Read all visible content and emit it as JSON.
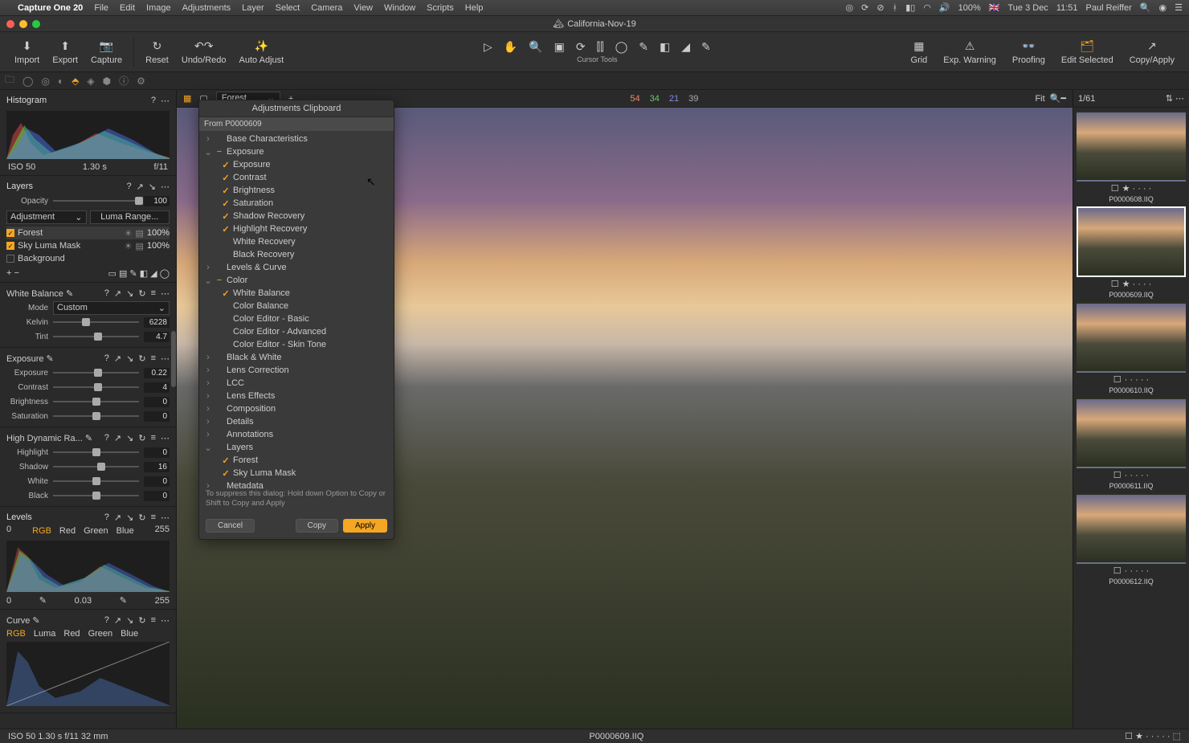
{
  "menubar": {
    "app": "Capture One 20",
    "items": [
      "File",
      "Edit",
      "Image",
      "Adjustments",
      "Layer",
      "Select",
      "Camera",
      "View",
      "Window",
      "Scripts",
      "Help"
    ],
    "battery": "100%",
    "flag": "🇬🇧",
    "date": "Tue 3 Dec",
    "time": "11:51",
    "user": "Paul Reiffer"
  },
  "window": {
    "title": "California-Nov-19",
    "doc_icon": "🏔"
  },
  "toolbar": {
    "left": [
      {
        "id": "import",
        "label": "Import",
        "icon": "⬇"
      },
      {
        "id": "export",
        "label": "Export",
        "icon": "⬆"
      },
      {
        "id": "capture",
        "label": "Capture",
        "icon": "📷"
      }
    ],
    "mid": [
      {
        "id": "reset",
        "label": "Reset",
        "icon": "↻"
      },
      {
        "id": "undoredo",
        "label": "Undo/Redo",
        "icon": "↶ ↷"
      },
      {
        "id": "autoadjust",
        "label": "Auto Adjust",
        "icon": "✨"
      }
    ],
    "cursor_label": "Cursor Tools",
    "right": [
      {
        "id": "grid",
        "label": "Grid",
        "icon": "▦"
      },
      {
        "id": "expwarn",
        "label": "Exp. Warning",
        "icon": "⚠"
      },
      {
        "id": "proofing",
        "label": "Proofing",
        "icon": "👓"
      },
      {
        "id": "editsel",
        "label": "Edit Selected",
        "icon": "🗂",
        "color": "#f5a623"
      },
      {
        "id": "copyapply",
        "label": "Copy/Apply",
        "icon": "↗"
      }
    ]
  },
  "histogram": {
    "iso": "ISO 50",
    "shutter": "1.30 s",
    "aperture": "f/11"
  },
  "layers": {
    "title": "Layers",
    "opacity_label": "Opacity",
    "opacity": "100",
    "adj_dd": "Adjustment",
    "luma": "Luma Range...",
    "items": [
      {
        "name": "Forest",
        "pct": "100%",
        "on": true,
        "sel": true
      },
      {
        "name": "Sky Luma Mask",
        "pct": "100%",
        "on": true
      },
      {
        "name": "Background",
        "pct": "",
        "on": false
      }
    ]
  },
  "wb": {
    "title": "White Balance",
    "mode_lbl": "Mode",
    "mode": "Custom",
    "kelvin_lbl": "Kelvin",
    "kelvin": "6228",
    "tint_lbl": "Tint",
    "tint": "4.7"
  },
  "exposure": {
    "title": "Exposure",
    "rows": [
      [
        "Exposure",
        "0.22",
        52
      ],
      [
        "Contrast",
        "4",
        52
      ],
      [
        "Brightness",
        "0",
        50
      ],
      [
        "Saturation",
        "0",
        50
      ]
    ]
  },
  "hdr": {
    "title": "High Dynamic Ra...",
    "rows": [
      [
        "Highlight",
        "0",
        50
      ],
      [
        "Shadow",
        "16",
        56
      ],
      [
        "White",
        "0",
        50
      ],
      [
        "Black",
        "0",
        50
      ]
    ]
  },
  "levels": {
    "title": "Levels",
    "in0": "0",
    "in1": "255",
    "tabs": [
      "RGB",
      "Red",
      "Green",
      "Blue"
    ],
    "lo": "0",
    "mid": "0.03",
    "hi": "255"
  },
  "curve": {
    "title": "Curve",
    "tabs": [
      "RGB",
      "Luma",
      "Red",
      "Green",
      "Blue"
    ]
  },
  "viewer": {
    "layer_dd": "Forest",
    "rgb": {
      "r": "54",
      "g": "34",
      "b": "21",
      "k": "39"
    },
    "zoom": "Fit",
    "count": "1/61"
  },
  "thumbs": [
    {
      "name": "P0000608.IIQ",
      "rating": 1
    },
    {
      "name": "P0000609.IIQ",
      "rating": 1,
      "sel": true
    },
    {
      "name": "P0000610.IIQ",
      "rating": 0
    },
    {
      "name": "P0000611.IIQ",
      "rating": 0
    },
    {
      "name": "P0000612.IIQ",
      "rating": 0
    }
  ],
  "status": {
    "left": "ISO 50   1.30 s   f/11   32 mm",
    "center": "P0000609.IIQ"
  },
  "dialog": {
    "title": "Adjustments Clipboard",
    "from": "From P0000609",
    "tree": [
      {
        "t": "grp",
        "arr": ">",
        "ck": "",
        "label": "Base Characteristics"
      },
      {
        "t": "grp",
        "arr": "v",
        "ck": "mix",
        "label": "Exposure"
      },
      {
        "t": "chl",
        "ck": "on",
        "label": "Exposure"
      },
      {
        "t": "chl",
        "ck": "on",
        "label": "Contrast"
      },
      {
        "t": "chl",
        "ck": "on",
        "label": "Brightness"
      },
      {
        "t": "chl",
        "ck": "on",
        "label": "Saturation"
      },
      {
        "t": "chl",
        "ck": "on",
        "label": "Shadow Recovery"
      },
      {
        "t": "chl",
        "ck": "on",
        "label": "Highlight Recovery"
      },
      {
        "t": "chl",
        "ck": "",
        "label": "White Recovery"
      },
      {
        "t": "chl",
        "ck": "",
        "label": "Black Recovery"
      },
      {
        "t": "grp",
        "arr": ">",
        "ck": "",
        "label": "Levels & Curve"
      },
      {
        "t": "grp",
        "arr": "v",
        "ck": "mix",
        "label": "Color"
      },
      {
        "t": "chl",
        "ck": "on",
        "label": "White Balance"
      },
      {
        "t": "chl",
        "ck": "",
        "label": "Color Balance"
      },
      {
        "t": "chl",
        "ck": "",
        "label": "Color Editor - Basic"
      },
      {
        "t": "chl",
        "ck": "",
        "label": "Color Editor - Advanced"
      },
      {
        "t": "chl",
        "ck": "",
        "label": "Color Editor - Skin Tone"
      },
      {
        "t": "grp",
        "arr": ">",
        "ck": "",
        "label": "Black & White"
      },
      {
        "t": "grp",
        "arr": ">",
        "ck": "",
        "label": "Lens Correction"
      },
      {
        "t": "grp",
        "arr": ">",
        "ck": "",
        "label": "LCC"
      },
      {
        "t": "grp",
        "arr": ">",
        "ck": "",
        "label": "Lens Effects"
      },
      {
        "t": "grp",
        "arr": ">",
        "ck": "",
        "label": "Composition"
      },
      {
        "t": "grp",
        "arr": ">",
        "ck": "",
        "label": "Details"
      },
      {
        "t": "grp",
        "arr": ">",
        "ck": "",
        "label": "Annotations"
      },
      {
        "t": "grp",
        "arr": "v",
        "ck": "",
        "label": "Layers"
      },
      {
        "t": "chl",
        "ck": "on",
        "label": "Forest"
      },
      {
        "t": "chl",
        "ck": "on",
        "label": "Sky Luma Mask"
      },
      {
        "t": "grp",
        "arr": ">",
        "ck": "",
        "label": "Metadata"
      }
    ],
    "hint": "To suppress this dialog: Hold down Option to Copy or Shift to Copy and Apply",
    "cancel": "Cancel",
    "copy": "Copy",
    "apply": "Apply"
  }
}
